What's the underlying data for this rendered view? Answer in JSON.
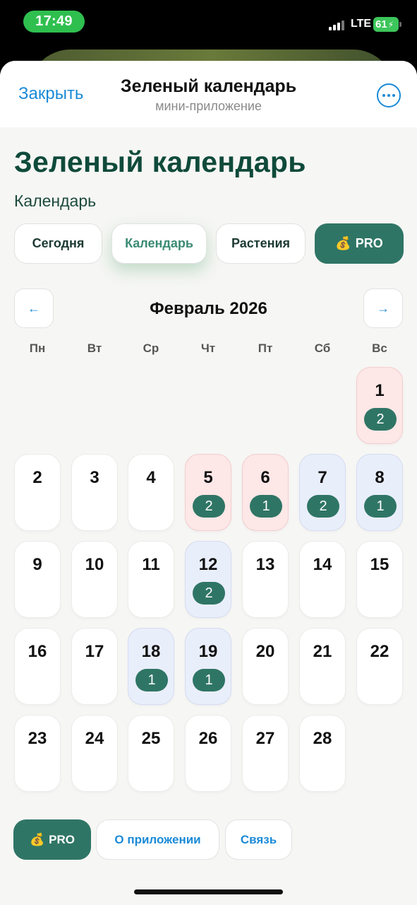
{
  "status_bar": {
    "time": "17:49",
    "network": "LTE",
    "battery": "61"
  },
  "header": {
    "close_label": "Закрыть",
    "title": "Зеленый календарь",
    "subtitle": "мини-приложение",
    "more_icon": "ellipsis-icon"
  },
  "page": {
    "title": "Зеленый календарь",
    "section": "Календарь"
  },
  "tabs": [
    {
      "label": "Сегодня",
      "active": false
    },
    {
      "label": "Календарь",
      "active": true
    },
    {
      "label": "Растения",
      "active": false
    },
    {
      "label": "PRO",
      "icon": "💰",
      "active": false
    }
  ],
  "calendar": {
    "month_label": "Февраль 2026",
    "prev_icon": "←",
    "next_icon": "→",
    "weekdays": [
      "Пн",
      "Вт",
      "Ср",
      "Чт",
      "Пт",
      "Сб",
      "Вс"
    ],
    "days": [
      {
        "day": "1",
        "count": "2",
        "style": "pink"
      },
      {
        "day": "2"
      },
      {
        "day": "3"
      },
      {
        "day": "4"
      },
      {
        "day": "5",
        "count": "2",
        "style": "pink"
      },
      {
        "day": "6",
        "count": "1",
        "style": "pink"
      },
      {
        "day": "7",
        "count": "2",
        "style": "blue"
      },
      {
        "day": "8",
        "count": "1",
        "style": "blue"
      },
      {
        "day": "9"
      },
      {
        "day": "10"
      },
      {
        "day": "11"
      },
      {
        "day": "12",
        "count": "2",
        "style": "blue"
      },
      {
        "day": "13"
      },
      {
        "day": "14"
      },
      {
        "day": "15"
      },
      {
        "day": "16"
      },
      {
        "day": "17"
      },
      {
        "day": "18",
        "count": "1",
        "style": "blue"
      },
      {
        "day": "19",
        "count": "1",
        "style": "blue"
      },
      {
        "day": "20"
      },
      {
        "day": "21"
      },
      {
        "day": "22"
      },
      {
        "day": "23"
      },
      {
        "day": "24"
      },
      {
        "day": "25"
      },
      {
        "day": "26"
      },
      {
        "day": "27"
      },
      {
        "day": "28"
      }
    ]
  },
  "footer": {
    "pro_label": "PRO",
    "pro_icon": "💰",
    "about_label": "О приложении",
    "contact_label": "Связь"
  },
  "colors": {
    "accent": "#2f7565",
    "link": "#1a8ad6",
    "title": "#0f4a3a",
    "pink_day": "#fde7e7",
    "blue_day": "#e9eefb"
  }
}
